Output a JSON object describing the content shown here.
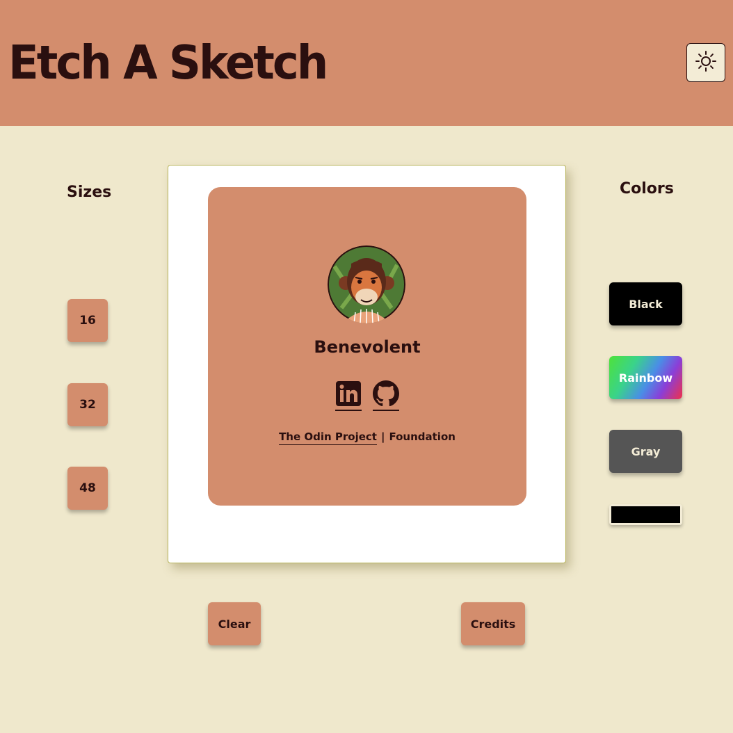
{
  "header": {
    "title": "Etch A Sketch",
    "theme_icon": "sun-icon"
  },
  "sizes": {
    "title": "Sizes",
    "options": [
      "16",
      "32",
      "48"
    ]
  },
  "colors": {
    "title": "Colors",
    "options": [
      {
        "label": "Black",
        "color": "#000000"
      },
      {
        "label": "Rainbow",
        "color": "gradient"
      },
      {
        "label": "Gray",
        "color": "#555555"
      }
    ],
    "picker_value": "#000000"
  },
  "credits": {
    "name": "Benevolent",
    "social": [
      "linkedin-icon",
      "github-icon"
    ],
    "link_text": "The Odin Project",
    "separator": "|",
    "suffix": "Foundation"
  },
  "actions": {
    "clear": "Clear",
    "credits": "Credits"
  },
  "theme": {
    "header_bg": "#d38d6d",
    "page_bg": "#efe8cc",
    "text": "#2a0f0f"
  }
}
